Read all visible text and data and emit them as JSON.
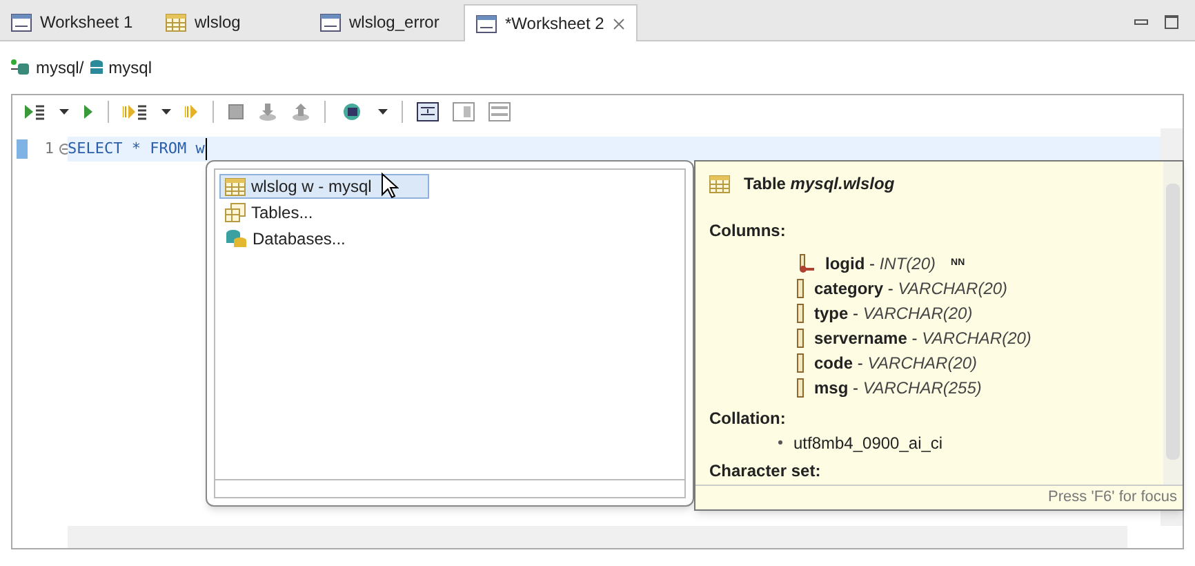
{
  "tabs": [
    {
      "label": "Worksheet 1",
      "kind": "sql",
      "selected": false
    },
    {
      "label": "wlslog",
      "kind": "table",
      "selected": false
    },
    {
      "label": "wlslog_error",
      "kind": "sql",
      "selected": false
    },
    {
      "label": "*Worksheet 2",
      "kind": "sql",
      "selected": true
    }
  ],
  "breadcrumb": {
    "connection": "mysql/",
    "database": "mysql"
  },
  "editor": {
    "line_number": "1",
    "code": "SELECT * FROM w"
  },
  "proposals": [
    {
      "label": "wlslog w - mysql",
      "kind": "table",
      "selected": true
    },
    {
      "label": "Tables...",
      "kind": "tables",
      "selected": false
    },
    {
      "label": "Databases...",
      "kind": "databases",
      "selected": false
    }
  ],
  "info": {
    "title": "Table *mysql.wlslog*",
    "columns_heading": "Columns:",
    "columns": [
      {
        "name": "logid",
        "dash": "-",
        "type": "INT(20)",
        "primary_key": true,
        "flag": "NN"
      },
      {
        "name": "category",
        "dash": "-",
        "type": "VARCHAR(20)",
        "primary_key": false
      },
      {
        "name": "type",
        "dash": "-",
        "type": "VARCHAR(20)",
        "primary_key": false
      },
      {
        "name": "servername",
        "dash": "-",
        "type": "VARCHAR(20)",
        "primary_key": false
      },
      {
        "name": "code",
        "dash": "-",
        "type": "VARCHAR(20)",
        "primary_key": false
      },
      {
        "name": "msg",
        "dash": "-",
        "type": "VARCHAR(255)",
        "primary_key": false
      }
    ],
    "collation_heading": "Collation:",
    "collations": [
      "utf8mb4_0900_ai_ci"
    ],
    "charset_heading": "Character set:",
    "footer": "Press 'F6' for focus"
  }
}
